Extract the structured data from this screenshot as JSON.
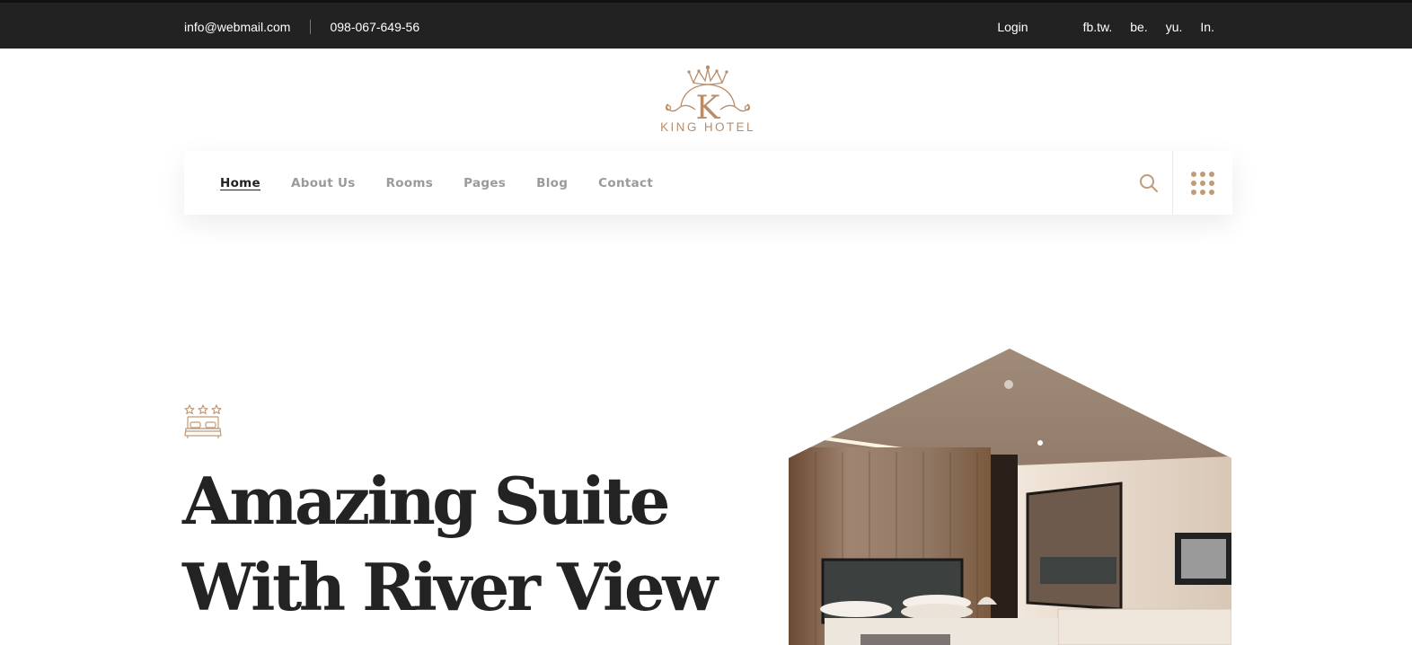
{
  "topbar": {
    "email": "info@webmail.com",
    "phone": "098-067-649-56",
    "login_label": "Login",
    "social": [
      "fb.tw.",
      "be.",
      "yu.",
      "In."
    ]
  },
  "logo": {
    "letter": "K",
    "name": "KING HOTEL",
    "color": "#b98d68"
  },
  "nav": {
    "items": [
      {
        "label": "Home",
        "active": true
      },
      {
        "label": "About Us",
        "active": false
      },
      {
        "label": "Rooms",
        "active": false
      },
      {
        "label": "Pages",
        "active": false
      },
      {
        "label": "Blog",
        "active": false
      },
      {
        "label": "Contact",
        "active": false
      }
    ],
    "search_icon": "search-icon",
    "menu_icon": "grid-dots-icon",
    "accent": "#c19a76"
  },
  "hero": {
    "icon": "three-star-bed-icon",
    "title_line1": "Amazing Suite",
    "title_line2": "With River View",
    "title_line3": "",
    "image_alt": "hotel-bedroom-photo"
  }
}
